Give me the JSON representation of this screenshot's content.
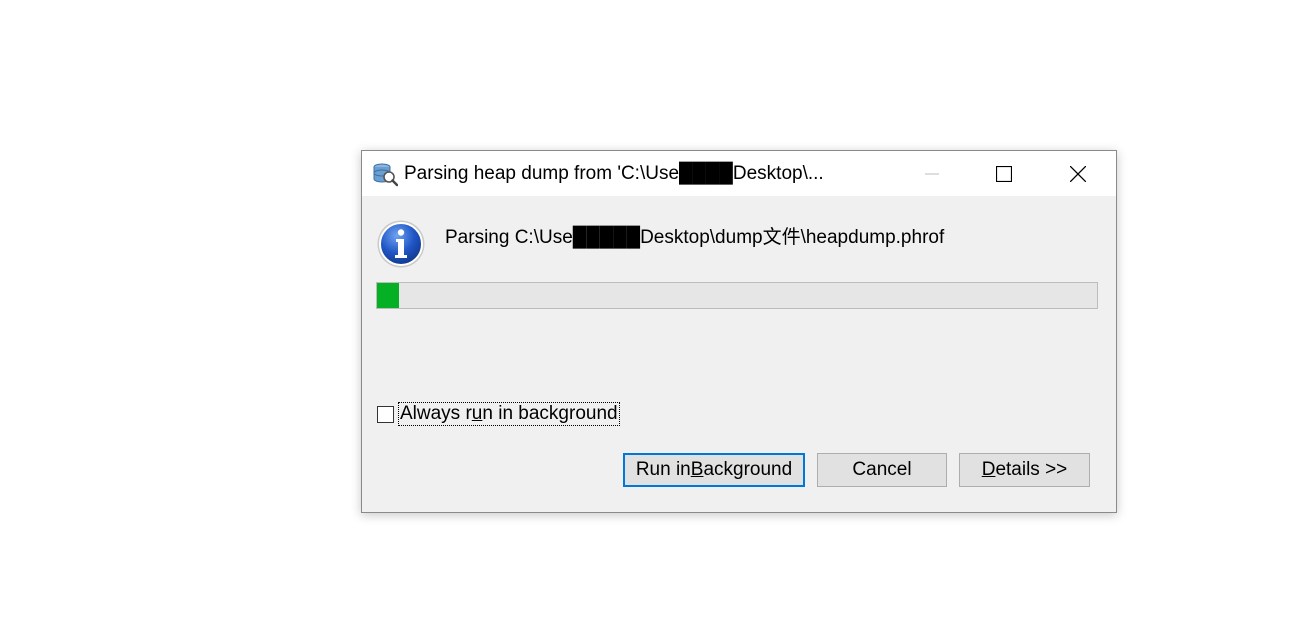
{
  "window": {
    "title": "Parsing heap dump from 'C:\\Use████Desktop\\...",
    "icon": "heap-analyzer-icon",
    "controls": [
      "minimize-icon",
      "maximize-icon",
      "close-icon"
    ]
  },
  "message": {
    "icon": "info-icon",
    "text": "Parsing C:\\Use█████Desktop\\dump文件\\heapdump.phrof"
  },
  "progress": {
    "percent": 3,
    "color": "#06b025"
  },
  "checkbox": {
    "checked": false,
    "label_before": "Always r",
    "label_mnemonic": "u",
    "label_after": "n in background"
  },
  "buttons": {
    "run_in_background": {
      "before": "Run in ",
      "mnemonic": "B",
      "after": "ackground"
    },
    "cancel": {
      "label": "Cancel"
    },
    "details": {
      "mnemonic": "D",
      "after": "etails >>"
    }
  },
  "colors": {
    "accent": "#0078d7",
    "dialog_bg": "#f0f0f0",
    "progress_track": "#e6e6e6"
  }
}
